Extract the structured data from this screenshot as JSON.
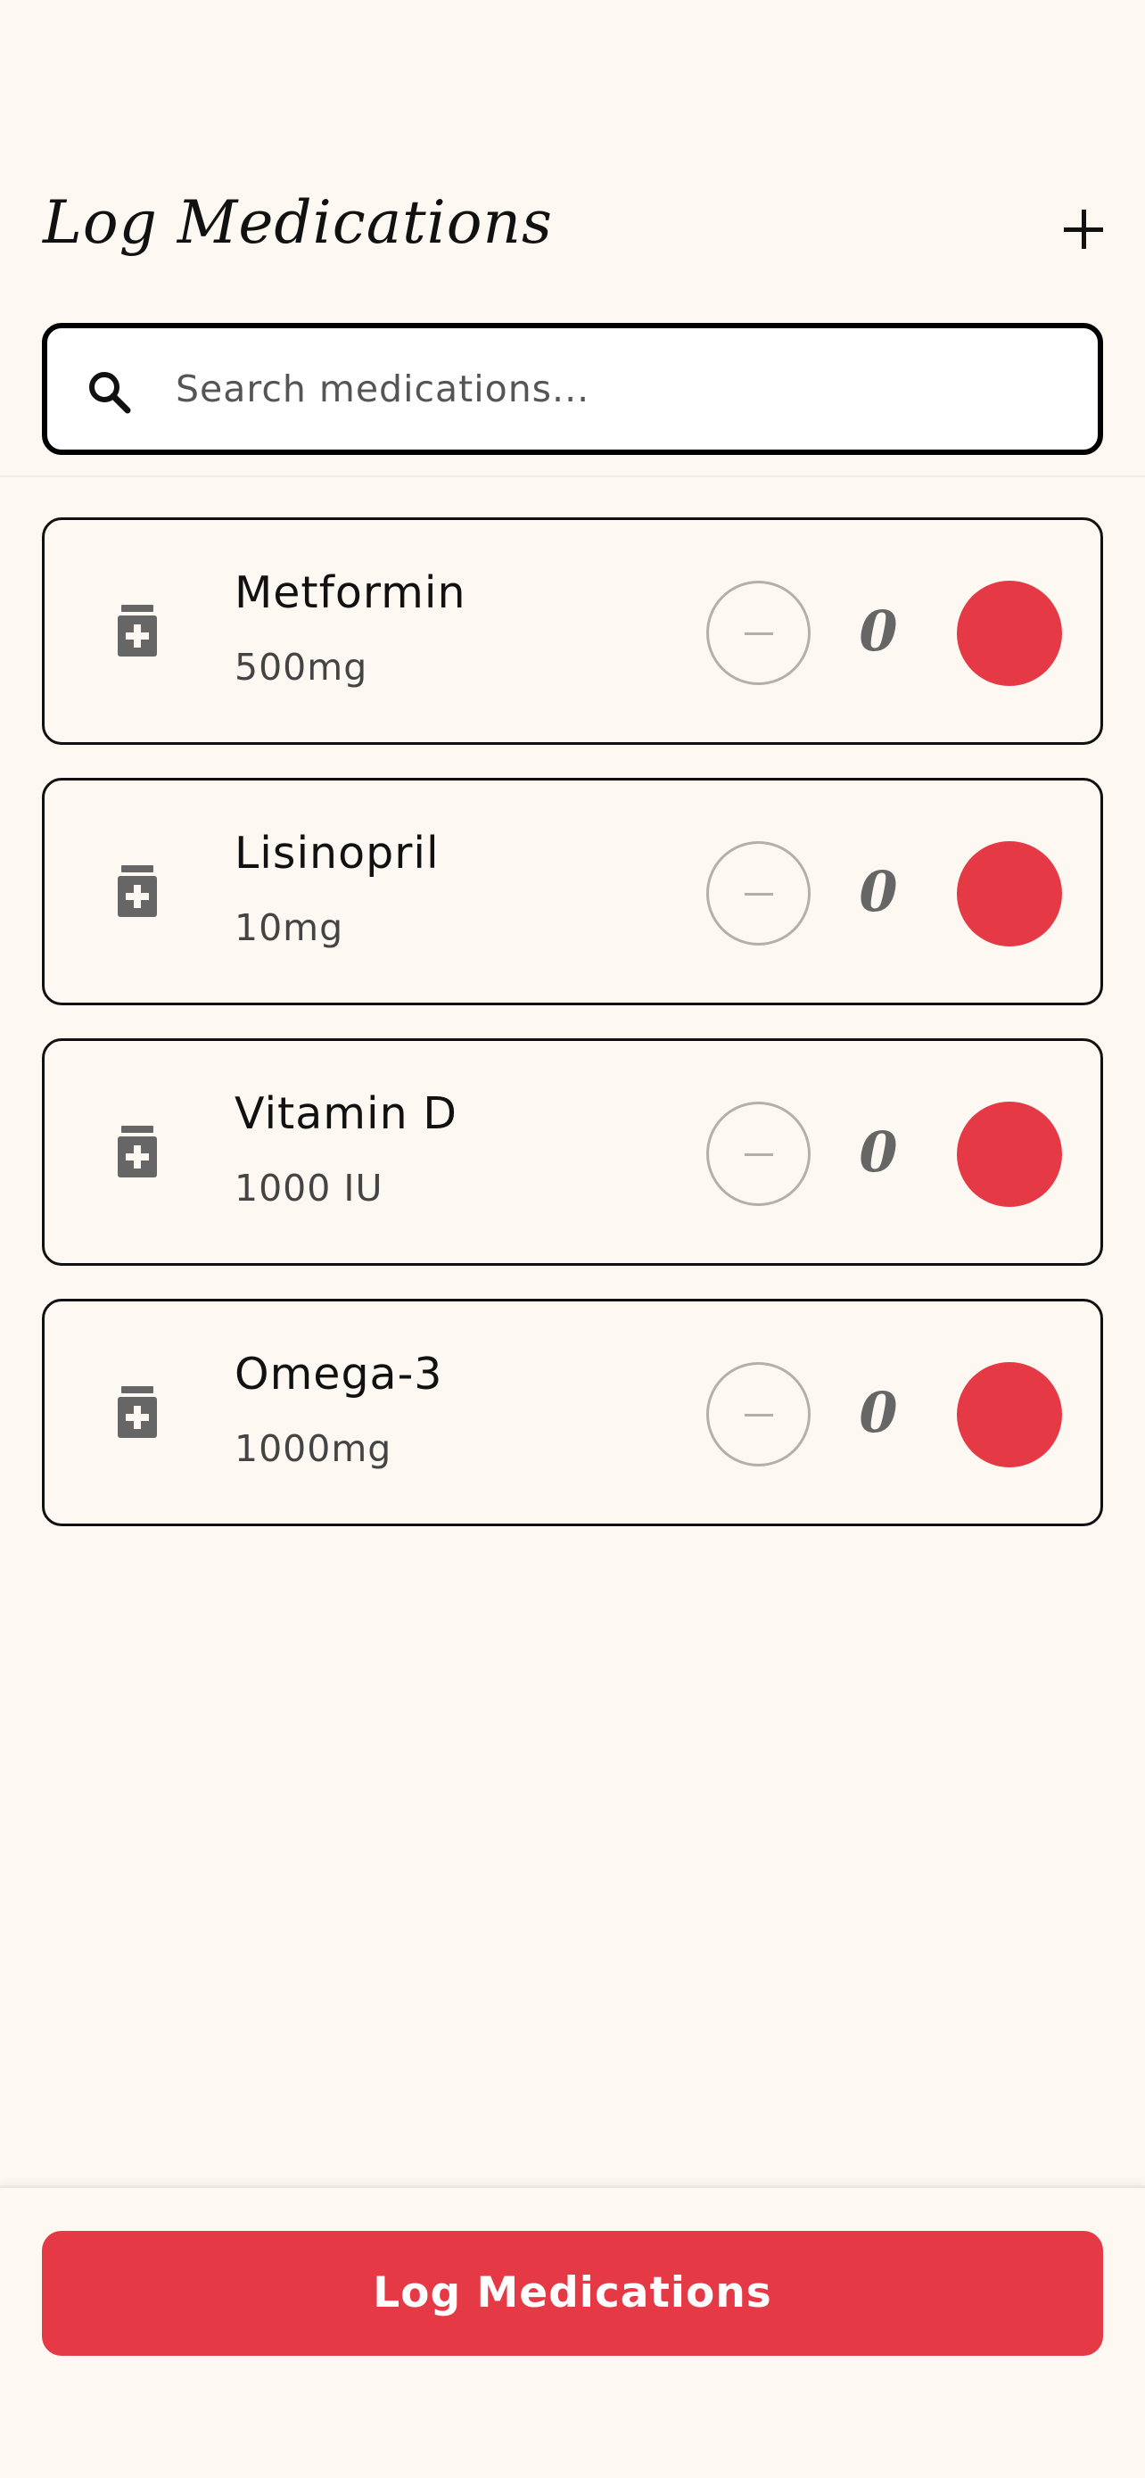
{
  "header": {
    "title": "Log Medications",
    "add_icon": "plus-icon"
  },
  "search": {
    "icon": "search-icon",
    "placeholder": "Search medications...",
    "value": ""
  },
  "medications": [
    {
      "name": "Metformin",
      "dose": "500mg",
      "count": "0",
      "icon": "pill-bottle-icon"
    },
    {
      "name": "Lisinopril",
      "dose": "10mg",
      "count": "0",
      "icon": "pill-bottle-icon"
    },
    {
      "name": "Vitamin D",
      "dose": "1000 IU",
      "count": "0",
      "icon": "pill-bottle-icon"
    },
    {
      "name": "Omega-3",
      "dose": "1000mg",
      "count": "0",
      "icon": "pill-bottle-icon"
    }
  ],
  "footer": {
    "log_button_label": "Log Medications"
  },
  "colors": {
    "background": "#fdf8f2",
    "accent": "#e63946",
    "border": "#111111",
    "muted": "#b3b0ab"
  }
}
